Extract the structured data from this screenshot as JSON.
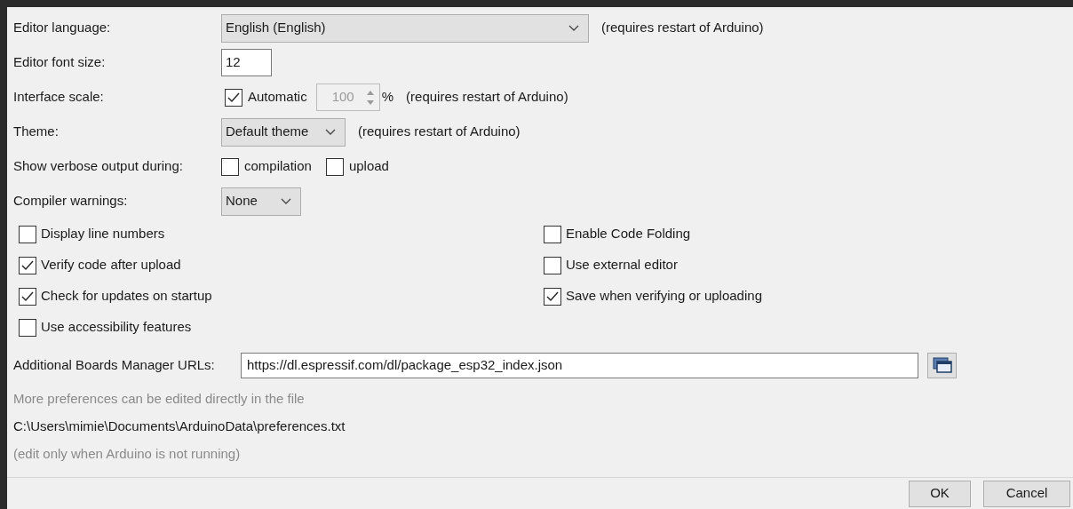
{
  "settings": [
    {
      "kind": "dropdown",
      "label": "Editor language:",
      "value": "English (English)",
      "note": "(requires restart of Arduino)"
    },
    {
      "kind": "text",
      "label": "Editor font size:",
      "value": "12"
    },
    {
      "kind": "scale",
      "label": "Interface scale:",
      "checkbox": {
        "label": "Automatic",
        "checked": true
      },
      "value": "100",
      "unit": "%",
      "disabled": true,
      "note": "(requires restart of Arduino)"
    },
    {
      "kind": "dropdown",
      "label": "Theme:",
      "value": "Default theme",
      "note": "(requires restart of Arduino)"
    },
    {
      "kind": "checks",
      "label": "Show verbose output during:",
      "options": [
        {
          "label": "compilation",
          "checked": false
        },
        {
          "label": "upload",
          "checked": false
        }
      ]
    },
    {
      "kind": "dropdown",
      "label": "Compiler warnings:",
      "value": "None"
    }
  ],
  "options_left": [
    {
      "label": "Display line numbers",
      "checked": false
    },
    {
      "label": "Verify code after upload",
      "checked": true
    },
    {
      "label": "Check for updates on startup",
      "checked": true
    },
    {
      "label": "Use accessibility features",
      "checked": false
    }
  ],
  "options_right": [
    {
      "label": "Enable Code Folding",
      "checked": false
    },
    {
      "label": "Use external editor",
      "checked": false
    },
    {
      "label": "Save when verifying or uploading",
      "checked": true
    }
  ],
  "urls": {
    "label": "Additional Boards Manager URLs:",
    "value": "https://dl.espressif.com/dl/package_esp32_index.json"
  },
  "info": [
    {
      "text": "More preferences can be edited directly in the file",
      "muted": true
    },
    {
      "text": "C:\\Users\\mimie\\Documents\\ArduinoData\\preferences.txt",
      "muted": false
    },
    {
      "text": "(edit only when Arduino is not running)",
      "muted": true
    }
  ],
  "buttons": [
    "OK",
    "Cancel"
  ]
}
